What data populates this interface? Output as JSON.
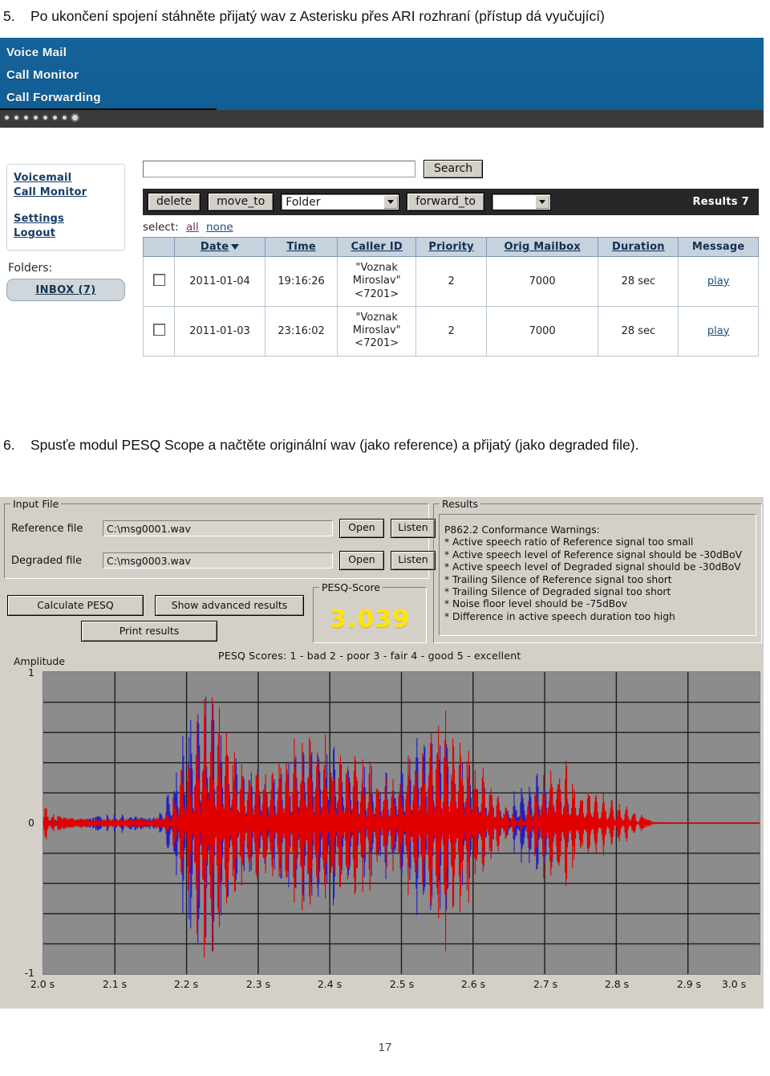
{
  "document": {
    "page_number": "17",
    "steps": [
      {
        "number": "5.",
        "text": "Po ukončení spojení stáhněte přijatý wav z Asterisku přes ARI rozhraní (přístup dá vyučující)"
      },
      {
        "number": "6.",
        "text": "Spusťe modul PESQ Scope a načtěte originální wav (jako reference) a přijatý (jako degraded file)."
      }
    ]
  },
  "voicemail_app": {
    "header": {
      "links": [
        "Voice Mail",
        "Call Monitor",
        "Call Forwarding"
      ]
    },
    "sidebar": {
      "links": [
        "Voicemail",
        "Call Monitor",
        "Settings",
        "Logout"
      ],
      "folders_label": "Folders:",
      "inbox": "INBOX (7)"
    },
    "search": {
      "value": "",
      "placeholder": "",
      "button": "Search"
    },
    "actionbar": {
      "delete": "delete",
      "move_to": "move_to",
      "folder_select": "Folder",
      "forward_to": "forward_to",
      "forward_select": "",
      "results": "Results 7"
    },
    "select_row": {
      "label": "select:",
      "all": "all",
      "none": "none"
    },
    "table": {
      "columns": [
        "",
        "Date",
        "Time",
        "Caller ID",
        "Priority",
        "Orig Mailbox",
        "Duration",
        "Message"
      ],
      "rows": [
        {
          "date": "2011-01-04",
          "time": "19:16:26",
          "caller_id": "\"Voznak\nMiroslav\"\n<7201>",
          "priority": "2",
          "orig_mailbox": "7000",
          "duration": "28 sec",
          "message": "play"
        },
        {
          "date": "2011-01-03",
          "time": "23:16:02",
          "caller_id": "\"Voznak\nMiroslav\"\n<7201>",
          "priority": "2",
          "orig_mailbox": "7000",
          "duration": "28 sec",
          "message": "play"
        }
      ]
    }
  },
  "pesq_app": {
    "input_file": {
      "caption": "Input File",
      "reference_label": "Reference file",
      "reference_value": "C:\\msg0001.wav",
      "degraded_label": "Degraded file",
      "degraded_value": "C:\\msg0003.wav",
      "open_button": "Open",
      "listen_button": "Listen"
    },
    "buttons": {
      "calculate": "Calculate PESQ",
      "advanced": "Show advanced results",
      "print": "Print results"
    },
    "score": {
      "caption": "PESQ-Score",
      "value": "3.039",
      "color": "#ffe500"
    },
    "results": {
      "caption": "Results",
      "lines": [
        "P862.2 Conformance Warnings:",
        "* Active speech ratio of Reference signal too small",
        "* Active speech level of Reference signal should be -30dBoV",
        "* Active speech level of Degraded signal should be -30dBoV",
        "* Trailing Silence of Reference signal too short",
        "* Trailing Silence of Degraded signal too short",
        "* Noise floor level should be -75dBov",
        "* Difference in active speech duration too high"
      ]
    },
    "score_legend": "PESQ Scores:   1 - bad     2 - poor     3 - fair     4 - good     5 - excellent"
  },
  "chart_data": {
    "type": "line",
    "title": "",
    "xlabel": "",
    "ylabel": "Amplitude",
    "xlim": [
      2.0,
      3.0
    ],
    "ylim": [
      -1,
      1
    ],
    "grid": true,
    "xticks": [
      "2.0 s",
      "2.1 s",
      "2.2 s",
      "2.3 s",
      "2.4 s",
      "2.5 s",
      "2.6 s",
      "2.7 s",
      "2.8 s",
      "2.9 s",
      "3.0 s"
    ],
    "yticks": [
      "1",
      "0",
      "-1"
    ],
    "plot_background": "#8c8c8c",
    "grid_color": "#1d1d1d",
    "series": [
      {
        "name": "reference",
        "color": "#e00000",
        "envelope_x": [
          2.0,
          2.005,
          2.01,
          2.02,
          2.03,
          2.05,
          2.07,
          2.09,
          2.11,
          2.13,
          2.15,
          2.17,
          2.19,
          2.21,
          2.23,
          2.25,
          2.27,
          2.29,
          2.31,
          2.33,
          2.35,
          2.37,
          2.39,
          2.41,
          2.43,
          2.45,
          2.47,
          2.49,
          2.51,
          2.53,
          2.55,
          2.57,
          2.59,
          2.61,
          2.63,
          2.65,
          2.67,
          2.69,
          2.71,
          2.73,
          2.75,
          2.8,
          2.85,
          2.9,
          2.95,
          3.0
        ],
        "envelope_y": [
          0.1,
          0.13,
          0.08,
          0.05,
          0.04,
          0.03,
          0.03,
          0.03,
          0.03,
          0.03,
          0.03,
          0.04,
          0.3,
          0.62,
          0.88,
          0.72,
          0.52,
          0.44,
          0.4,
          0.46,
          0.58,
          0.62,
          0.58,
          0.52,
          0.46,
          0.4,
          0.34,
          0.3,
          0.44,
          0.6,
          0.72,
          0.66,
          0.56,
          0.4,
          0.24,
          0.1,
          0.06,
          0.3,
          0.46,
          0.4,
          0.28,
          0.16,
          0.01,
          0.0,
          0.0,
          0.0
        ]
      },
      {
        "name": "degraded",
        "color": "#2020c8",
        "envelope_x": [
          2.0,
          2.02,
          2.04,
          2.06,
          2.08,
          2.1,
          2.12,
          2.14,
          2.16,
          2.18,
          2.2,
          2.22,
          2.24,
          2.26,
          2.28,
          2.3,
          2.32,
          2.34,
          2.36,
          2.38,
          2.4,
          2.42,
          2.44,
          2.46,
          2.48,
          2.5,
          2.52,
          2.54,
          2.56,
          2.58,
          2.6,
          2.62,
          2.64,
          2.66,
          2.68,
          2.7,
          2.72,
          2.74,
          2.76,
          2.8,
          2.85,
          2.9,
          2.95,
          3.0
        ],
        "envelope_y": [
          0.02,
          0.02,
          0.02,
          0.03,
          0.05,
          0.06,
          0.05,
          0.04,
          0.04,
          0.3,
          0.7,
          0.92,
          0.76,
          0.5,
          0.4,
          0.36,
          0.34,
          0.4,
          0.56,
          0.6,
          0.54,
          0.48,
          0.42,
          0.36,
          0.32,
          0.4,
          0.54,
          0.64,
          0.58,
          0.48,
          0.34,
          0.2,
          0.1,
          0.22,
          0.34,
          0.3,
          0.24,
          0.14,
          0.04,
          0.01,
          0.0,
          0.0,
          0.0,
          0.0
        ]
      }
    ]
  }
}
